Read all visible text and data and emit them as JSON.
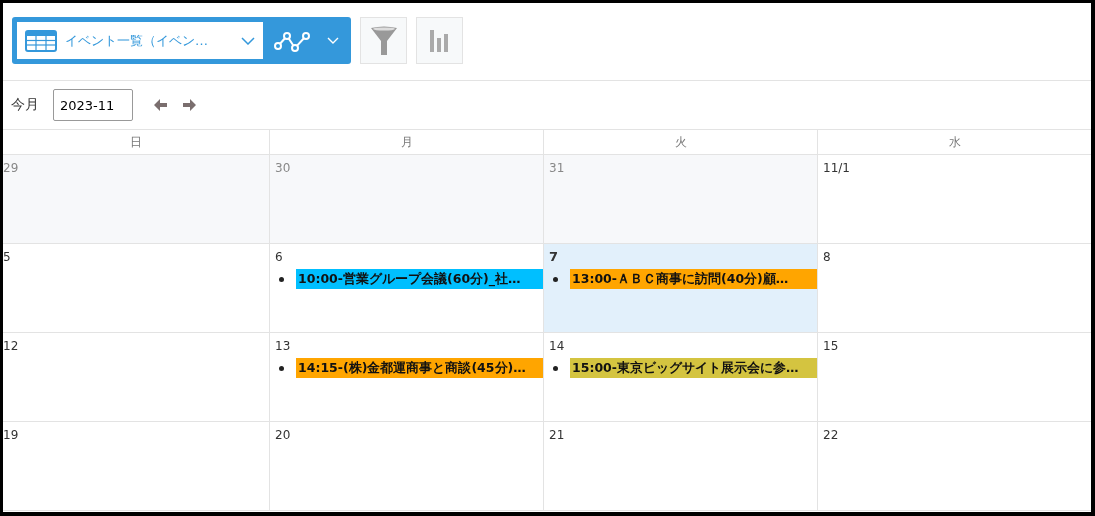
{
  "toolbar": {
    "view_name": "イベント一覧（イベン…"
  },
  "month_nav": {
    "label": "今月",
    "month_value": "2023-11"
  },
  "calendar": {
    "weekdays": [
      "日",
      "月",
      "火",
      "水"
    ],
    "weeks": [
      [
        {
          "date": "29",
          "outside_month": true,
          "today": false
        },
        {
          "date": "30",
          "outside_month": true,
          "today": false
        },
        {
          "date": "31",
          "outside_month": true,
          "today": false
        },
        {
          "date": "11/1",
          "outside_month": false,
          "today": false
        }
      ],
      [
        {
          "date": "5",
          "outside_month": false,
          "today": false
        },
        {
          "date": "6",
          "outside_month": false,
          "today": false,
          "events": [
            {
              "title": "10:00-営業グループ会議(60分)_社…",
              "color": "#00bfff"
            }
          ]
        },
        {
          "date": "7",
          "outside_month": false,
          "today": true,
          "events": [
            {
              "title": "13:00-ＡＢＣ商事に訪問(40分)顧…",
              "color": "#ffa500"
            }
          ]
        },
        {
          "date": "8",
          "outside_month": false,
          "today": false
        }
      ],
      [
        {
          "date": "12",
          "outside_month": false,
          "today": false
        },
        {
          "date": "13",
          "outside_month": false,
          "today": false,
          "events": [
            {
              "title": "14:15-(株)金都運商事と商談(45分)…",
              "color": "#ffa500"
            }
          ]
        },
        {
          "date": "14",
          "outside_month": false,
          "today": false,
          "events": [
            {
              "title": "15:00-東京ビッグサイト展示会に参…",
              "color": "#d4c440"
            }
          ]
        },
        {
          "date": "15",
          "outside_month": false,
          "today": false
        }
      ],
      [
        {
          "date": "19",
          "outside_month": false,
          "today": false
        },
        {
          "date": "20",
          "outside_month": false,
          "today": false
        },
        {
          "date": "21",
          "outside_month": false,
          "today": false
        },
        {
          "date": "22",
          "outside_month": false,
          "today": false
        }
      ]
    ]
  }
}
